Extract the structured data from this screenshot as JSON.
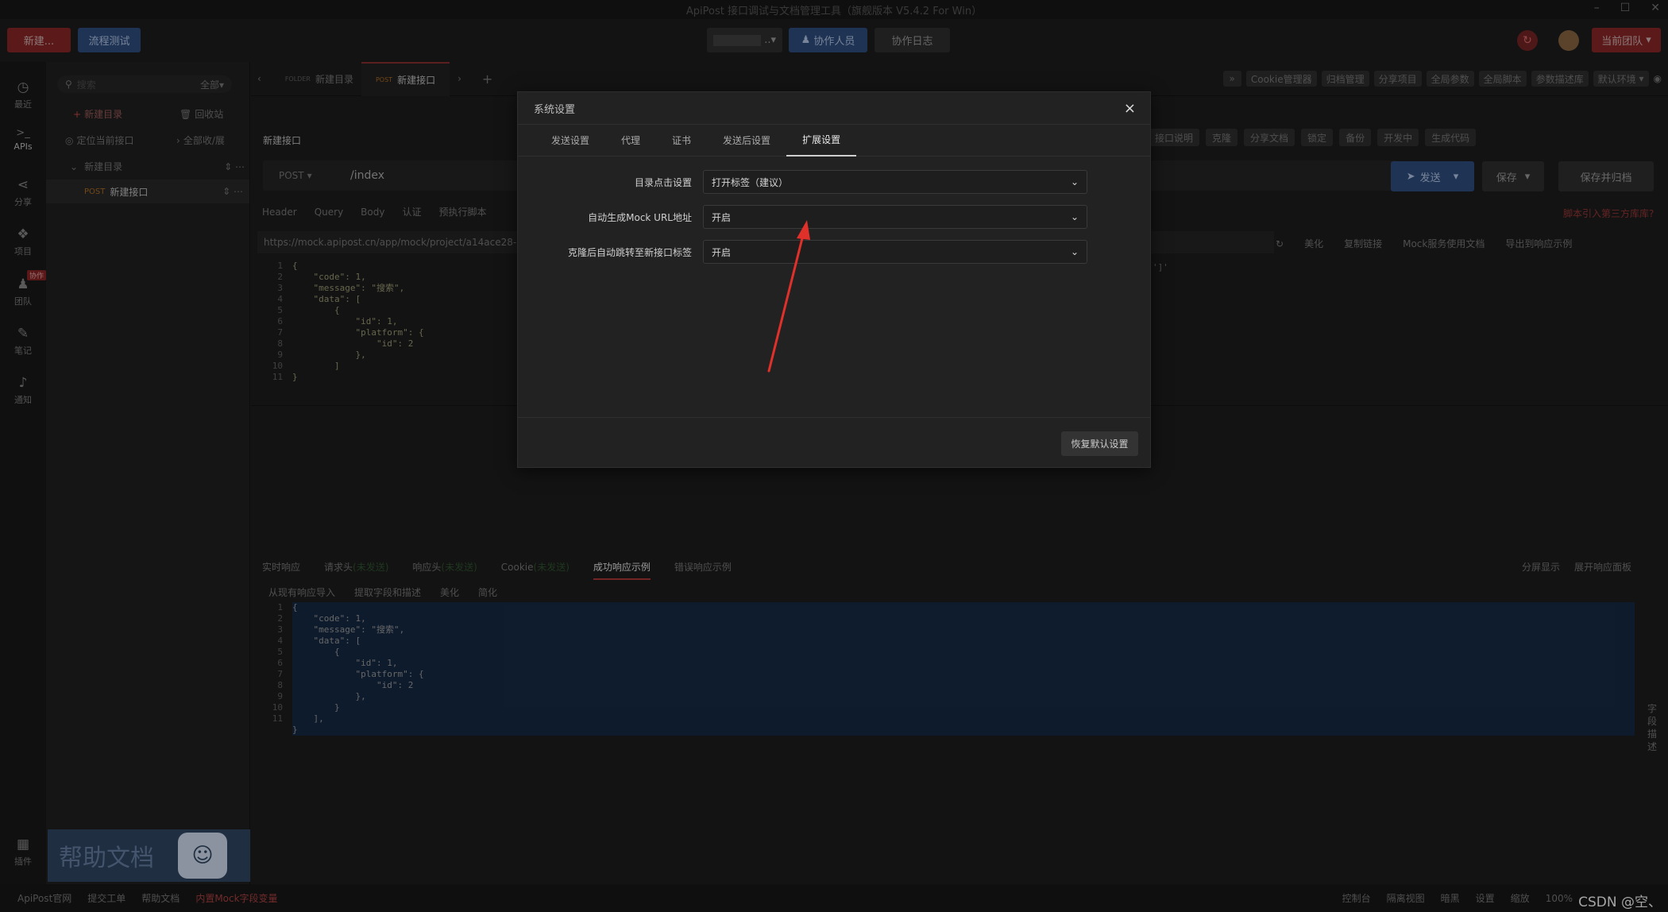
{
  "window": {
    "title": "ApiPost 接口调试与文档管理工具（旗舰版本 V5.4.2 For Win）",
    "controls": [
      "–",
      "☐",
      "✕"
    ]
  },
  "topbar": {
    "new_button": "新建...",
    "flow_test": "流程测试",
    "project_select": "..",
    "collaborators": "协作人员",
    "collab_log": "协作日志",
    "current_team": "当前团队"
  },
  "leftnav": [
    {
      "label": "最近",
      "icon": "clock-icon",
      "glyph": "◷"
    },
    {
      "label": "APIs",
      "icon": "terminal-icon",
      "glyph": ">_"
    },
    {
      "label": "分享",
      "icon": "share-icon",
      "glyph": "⋖"
    },
    {
      "label": "项目",
      "icon": "cubes-icon",
      "glyph": "❖"
    },
    {
      "label": "团队",
      "icon": "team-icon",
      "glyph": "♟",
      "badge": "协作"
    },
    {
      "label": "笔记",
      "icon": "edit-icon",
      "glyph": "✎"
    },
    {
      "label": "通知",
      "icon": "bell-icon",
      "glyph": "♪"
    },
    {
      "label": "插件",
      "icon": "grid-icon",
      "glyph": "▦"
    }
  ],
  "tree": {
    "search_placeholder": "搜索",
    "filter": "全部",
    "new_folder": "新建目录",
    "recycle": "回收站",
    "locate": "定位当前接口",
    "collapse": "全部收/展",
    "folder": "新建目录",
    "api_method": "POST",
    "api_name": "新建接口",
    "help_banner": "帮助文档"
  },
  "tabs": [
    {
      "tag": "FOLDER",
      "label": "新建目录"
    },
    {
      "tag": "POST",
      "label": "新建接口"
    }
  ],
  "toolbar_right": [
    "Cookie管理器",
    "归档管理",
    "分享项目",
    "全局参数",
    "全局脚本",
    "参数描述库",
    "默认环境"
  ],
  "api": {
    "title": "新建接口",
    "method": "POST",
    "url": "/index",
    "actions": [
      "接口说明",
      "克隆",
      "分享文档",
      "锁定",
      "备份",
      "开发中",
      "生成代码"
    ],
    "send": "发送",
    "save": "保存",
    "save_archive": "保存并归档",
    "third_party": "脚本引入第三方库库?",
    "req_tabs": [
      "Header",
      "Query",
      "Body",
      "认证",
      "预执行脚本"
    ],
    "mock_url": "https://mock.apipost.cn/app/mock/project/a14ace28-69a3-4a",
    "mock_tools": [
      "美化",
      "复制链接",
      "Mock服务使用文档",
      "导出到响应示例"
    ],
    "mock_tail": "']'"
  },
  "code_top": [
    "{",
    "    \"code\": 1,",
    "    \"message\": \"搜索\",",
    "    \"data\": [",
    "        {",
    "            \"id\": 1,",
    "            \"platform\": {",
    "                \"id\": 2",
    "            },",
    "        ]",
    "}"
  ],
  "response": {
    "tabs": [
      "实时响应",
      "请求头",
      "响应头",
      "Cookie",
      "成功响应示例",
      "错误响应示例"
    ],
    "tab_hints": [
      "",
      "(未发送)",
      "(未发送)",
      "(未发送)",
      "",
      ""
    ],
    "right": [
      "分屏显示",
      "展开响应面板"
    ],
    "tools": [
      "从现有响应导入",
      "提取字段和描述",
      "美化",
      "简化"
    ],
    "side_label": "字段描述"
  },
  "code_bottom": [
    "{",
    "    \"code\": 1,",
    "    \"message\": \"搜索\",",
    "    \"data\": [",
    "        {",
    "            \"id\": 1,",
    "            \"platform\": {",
    "                \"id\": 2",
    "            },",
    "        }",
    "    ],",
    "}"
  ],
  "modal": {
    "title": "系统设置",
    "close": "×",
    "tabs": [
      "发送设置",
      "代理",
      "证书",
      "发送后设置",
      "扩展设置"
    ],
    "active_tab": "扩展设置",
    "settings": [
      {
        "label": "目录点击设置",
        "value": "打开标签（建议）"
      },
      {
        "label": "自动生成Mock URL地址",
        "value": "开启"
      },
      {
        "label": "克隆后自动跳转至新接口标签",
        "value": "开启"
      }
    ],
    "reset": "恢复默认设置"
  },
  "statusbar": {
    "left": [
      "ApiPost官网",
      "提交工单",
      "帮助文档",
      "内置Mock字段变量"
    ],
    "right": [
      "控制台",
      "隔离视图",
      "暗黑",
      "设置",
      "缩放",
      "100%"
    ],
    "watermark": "CSDN @空、"
  },
  "colors": {
    "accent_red": "#7a2222",
    "accent_blue": "#2a4470",
    "annotation_arrow": "#e0302a"
  }
}
